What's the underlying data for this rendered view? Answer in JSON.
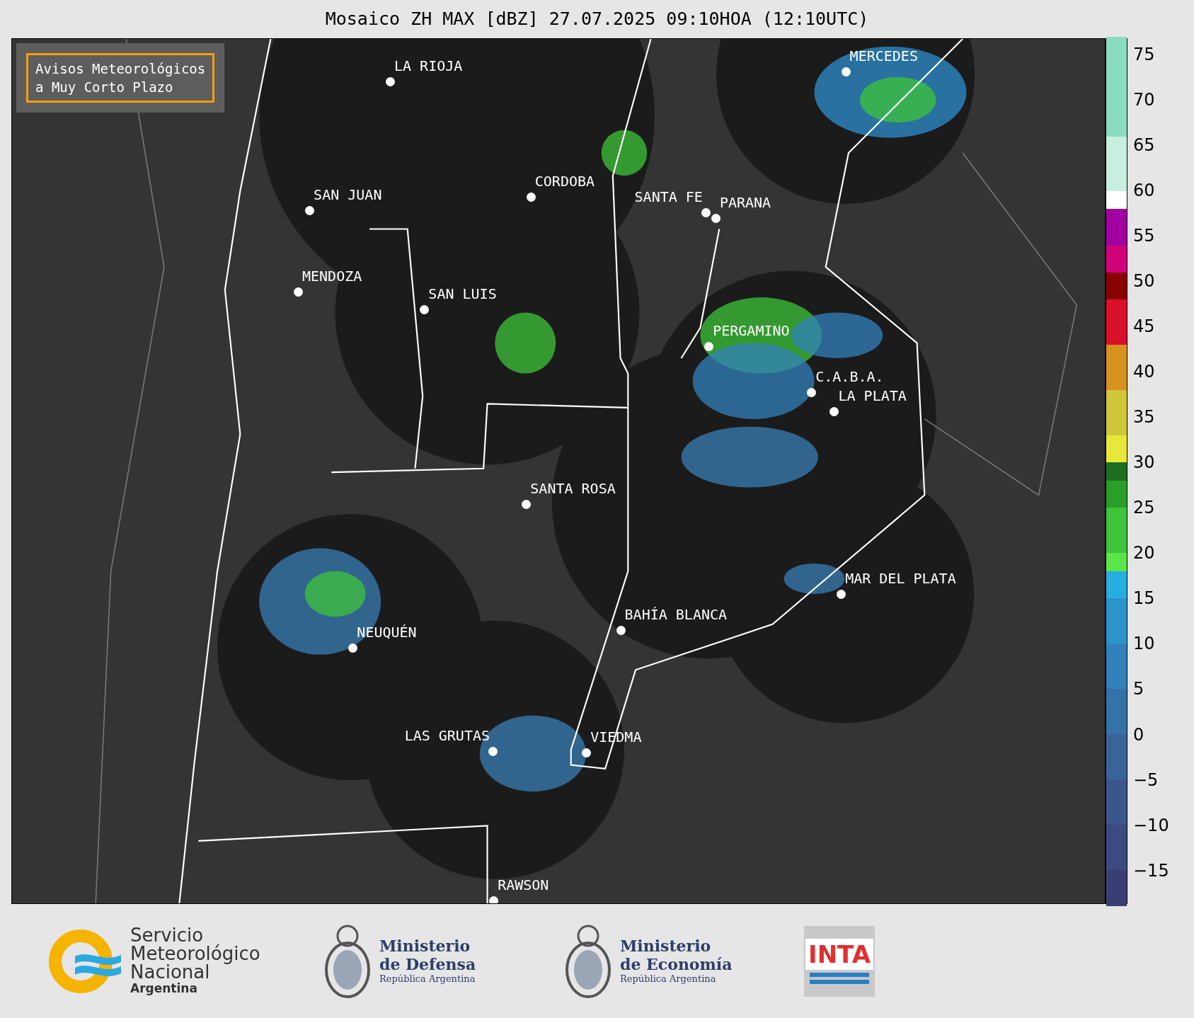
{
  "title": "Mosaico ZH MAX [dBZ] 27.07.2025 09:10HOA (12:10UTC)",
  "warning_box": {
    "lines": [
      "Avisos Meteorológicos",
      "a Muy Corto Plazo"
    ]
  },
  "cities": [
    {
      "name": "LA RIOJA"
    },
    {
      "name": "CORDOBA"
    },
    {
      "name": "SAN JUAN"
    },
    {
      "name": "SANTA FE"
    },
    {
      "name": "PARANA"
    },
    {
      "name": "MENDOZA"
    },
    {
      "name": "SAN LUIS"
    },
    {
      "name": "MERCEDES"
    },
    {
      "name": "PERGAMINO"
    },
    {
      "name": "C.A.B.A."
    },
    {
      "name": "LA PLATA"
    },
    {
      "name": "SANTA ROSA"
    },
    {
      "name": "MAR DEL PLATA"
    },
    {
      "name": "BAHÍA BLANCA"
    },
    {
      "name": "NEUQUÉN"
    },
    {
      "name": "LAS GRUTAS"
    },
    {
      "name": "VIEDMA"
    },
    {
      "name": "RAWSON"
    }
  ],
  "colorbar": {
    "ticks": [
      "75",
      "70",
      "65",
      "60",
      "55",
      "50",
      "45",
      "40",
      "35",
      "30",
      "25",
      "20",
      "15",
      "10",
      "5",
      "0",
      "−5",
      "−10",
      "−15"
    ]
  },
  "logos": [
    {
      "kind": "smn",
      "lines": [
        "Servicio",
        "Meteorológico",
        "Nacional",
        "Argentina"
      ]
    },
    {
      "kind": "ministry",
      "lines": [
        "Ministerio",
        "de Defensa",
        "República Argentina"
      ]
    },
    {
      "kind": "ministry",
      "lines": [
        "Ministerio",
        "de Economía",
        "República Argentina"
      ]
    },
    {
      "kind": "inta",
      "lines": [
        "INTA"
      ]
    }
  ]
}
